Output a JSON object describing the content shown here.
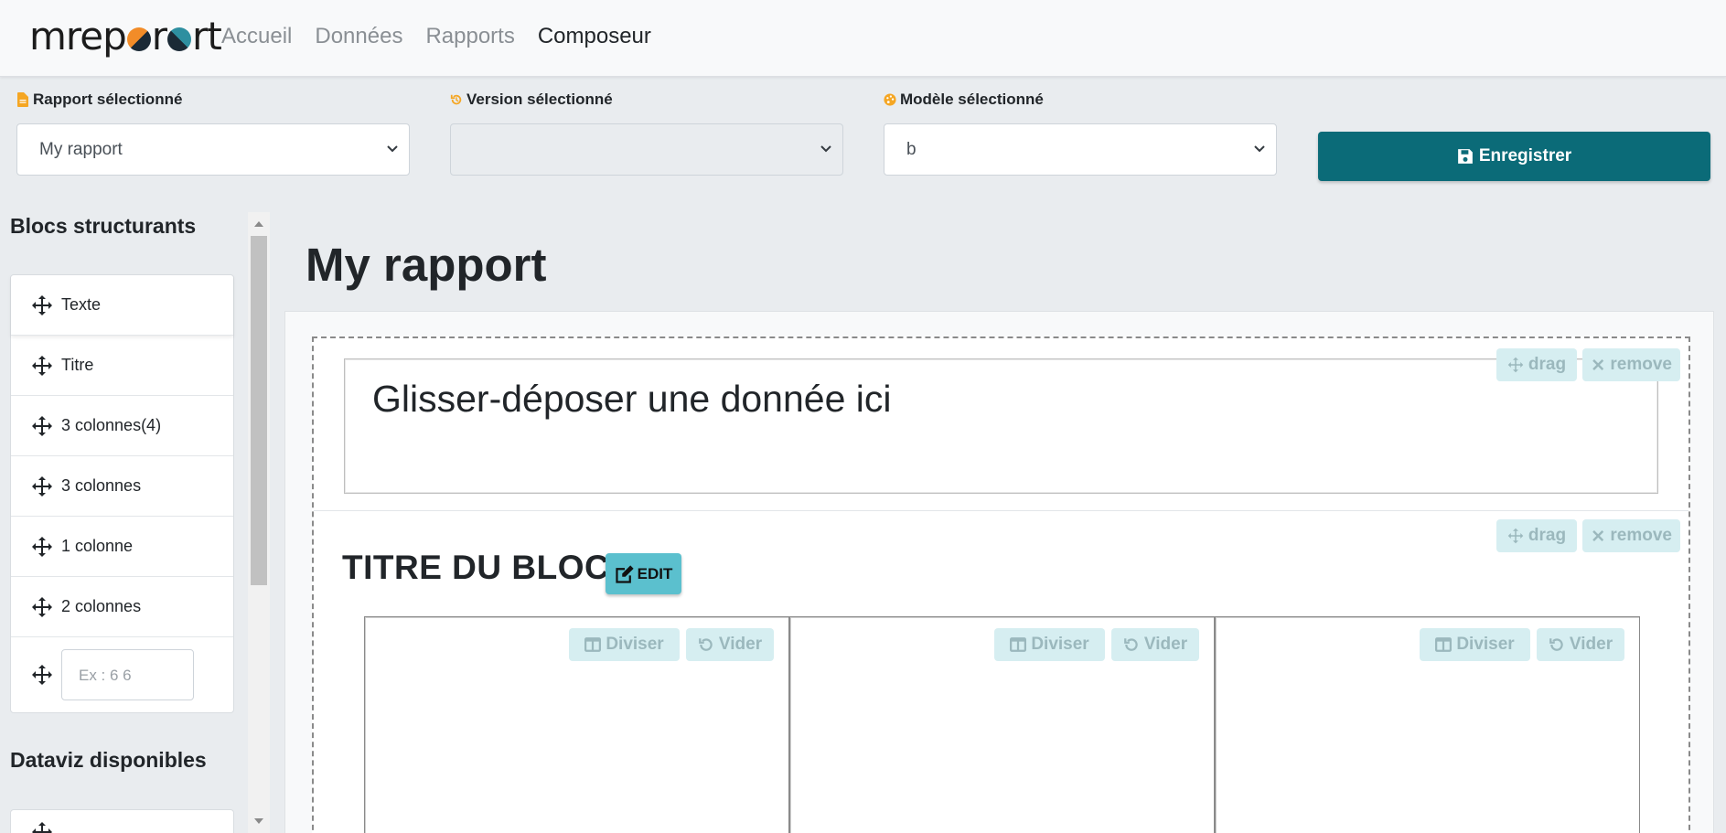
{
  "nav": {
    "brand": "mreport",
    "links": [
      {
        "label": "Accueil",
        "active": false
      },
      {
        "label": "Données",
        "active": false
      },
      {
        "label": "Rapports",
        "active": false
      },
      {
        "label": "Composeur",
        "active": true
      }
    ]
  },
  "selectors": {
    "rapport": {
      "label": "Rapport sélectionné",
      "value": "My rapport",
      "icon": "file-icon",
      "icon_color": "#f5a623"
    },
    "version": {
      "label": "Version sélectionné",
      "value": "",
      "icon": "history-icon",
      "icon_color": "#f5a623"
    },
    "modele": {
      "label": "Modèle sélectionné",
      "value": "b",
      "icon": "palette-icon",
      "icon_color": "#f5a623"
    }
  },
  "save_button": {
    "label": "Enregistrer",
    "color": "#0b6b78"
  },
  "sidebar": {
    "blocs_title": "Blocs structurants",
    "blocs": [
      "Texte",
      "Titre",
      "3 colonnes(4)",
      "3 colonnes",
      "1 colonne",
      "2 colonnes"
    ],
    "custom_columns_placeholder": "Ex : 6 6",
    "dataviz_title": "Dataviz disponibles"
  },
  "main": {
    "report_title": "My rapport",
    "drop_placeholder": "Glisser-déposer une donnée ici",
    "block_title": "TITRE DU BLOC",
    "edit_label": "EDIT",
    "drag_label": "drag",
    "remove_label": "remove",
    "split_label": "Diviser",
    "clear_label": "Vider"
  }
}
